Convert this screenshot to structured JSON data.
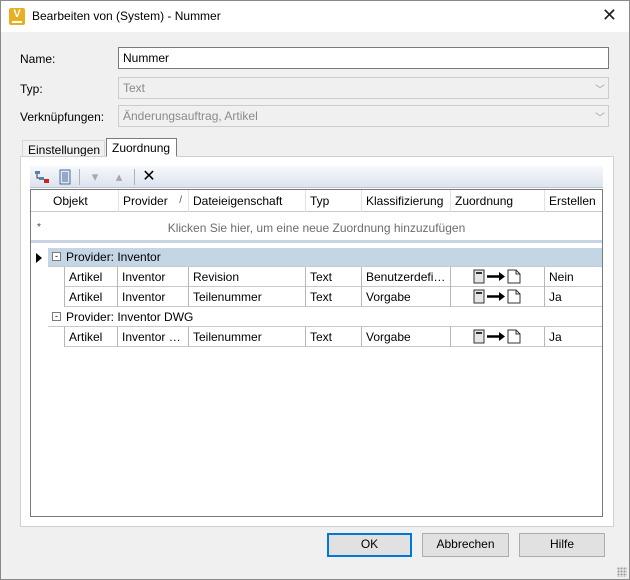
{
  "window": {
    "title": "Bearbeiten von (System) - Nummer",
    "app_icon": "V"
  },
  "form": {
    "name_label": "Name:",
    "name_value": "Nummer",
    "typ_label": "Typ:",
    "typ_value": "Text",
    "link_label": "Verknüpfungen:",
    "link_value": "Änderungsauftrag, Artikel"
  },
  "tabs": [
    {
      "label": "Einstellungen",
      "active": false
    },
    {
      "label": "Zuordnung",
      "active": true
    }
  ],
  "grid": {
    "columns": [
      "Objekt",
      "Provider",
      "Dateieigenschaft",
      "Typ",
      "Klassifizierung",
      "Zuordnung",
      "Erstellen"
    ],
    "sort_indicator": "/",
    "new_row_star": "*",
    "new_row_hint": "Klicken Sie hier, um eine neue Zuordnung hinzuzufügen",
    "groups": [
      {
        "label": "Provider: Inventor",
        "expander": "-",
        "rows": [
          {
            "objekt": "Artikel",
            "provider": "Inventor",
            "eigenschaft": "Revision",
            "typ": "Text",
            "klassifizierung": "Benutzerdefin…",
            "erstellen": "Nein"
          },
          {
            "objekt": "Artikel",
            "provider": "Inventor",
            "eigenschaft": "Teilenummer",
            "typ": "Text",
            "klassifizierung": "Vorgabe",
            "erstellen": "Ja"
          }
        ]
      },
      {
        "label": "Provider: Inventor DWG",
        "expander": "-",
        "rows": [
          {
            "objekt": "Artikel",
            "provider": "Inventor D…",
            "eigenschaft": "Teilenummer",
            "typ": "Text",
            "klassifizierung": "Vorgabe",
            "erstellen": "Ja"
          }
        ]
      }
    ]
  },
  "buttons": {
    "ok": "OK",
    "cancel": "Abbrechen",
    "help": "Hilfe"
  },
  "colors": {
    "accent": "#0078d7",
    "selected_group": "#c4d6e6",
    "toolbar_red": "#cc2222"
  }
}
